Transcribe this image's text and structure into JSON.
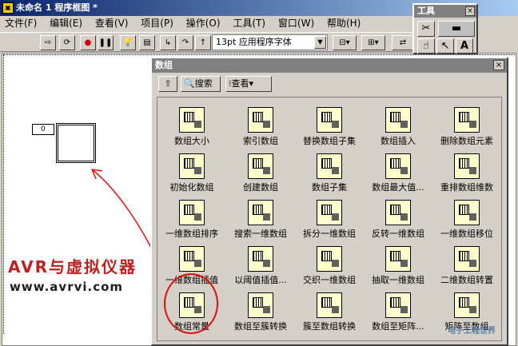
{
  "window": {
    "title": "未命名 1 程序框图 *",
    "icon": "labview-icon"
  },
  "menu": [
    "文件(F)",
    "编辑(E)",
    "查看(V)",
    "项目(P)",
    "操作(O)",
    "工具(T)",
    "窗口(W)",
    "帮助(H)"
  ],
  "toolbar": {
    "font": "13pt 应用程序字体"
  },
  "tools_palette": {
    "title": "工具"
  },
  "palette": {
    "title": "数组",
    "search": "搜索",
    "view": "查看",
    "items": [
      "数组大小",
      "索引数组",
      "替换数组子集",
      "数组插入",
      "删除数组元素",
      "初始化数组",
      "创建数组",
      "数组子集",
      "数组最大值...",
      "重排数组维数",
      "一维数组排序",
      "搜索一维数组",
      "拆分一维数组",
      "反转一维数组",
      "一维数组移位",
      "一维数组插值",
      "以阈值插值...",
      "交织一维数组",
      "抽取一维数组",
      "二维数组转置",
      "数组常量",
      "数组至簇转换",
      "簇至数组转换",
      "数组至矩阵...",
      "矩阵至数组"
    ]
  },
  "diagram": {
    "index": "0"
  },
  "watermark": {
    "line1": "AVR与虚拟仪器",
    "line2": "www.avrvi.com",
    "corner": "电子工程世界"
  },
  "colors": {
    "annotation": "#e01010",
    "title_active": "#0a246a",
    "palette_bg": "#d4d0c8"
  }
}
